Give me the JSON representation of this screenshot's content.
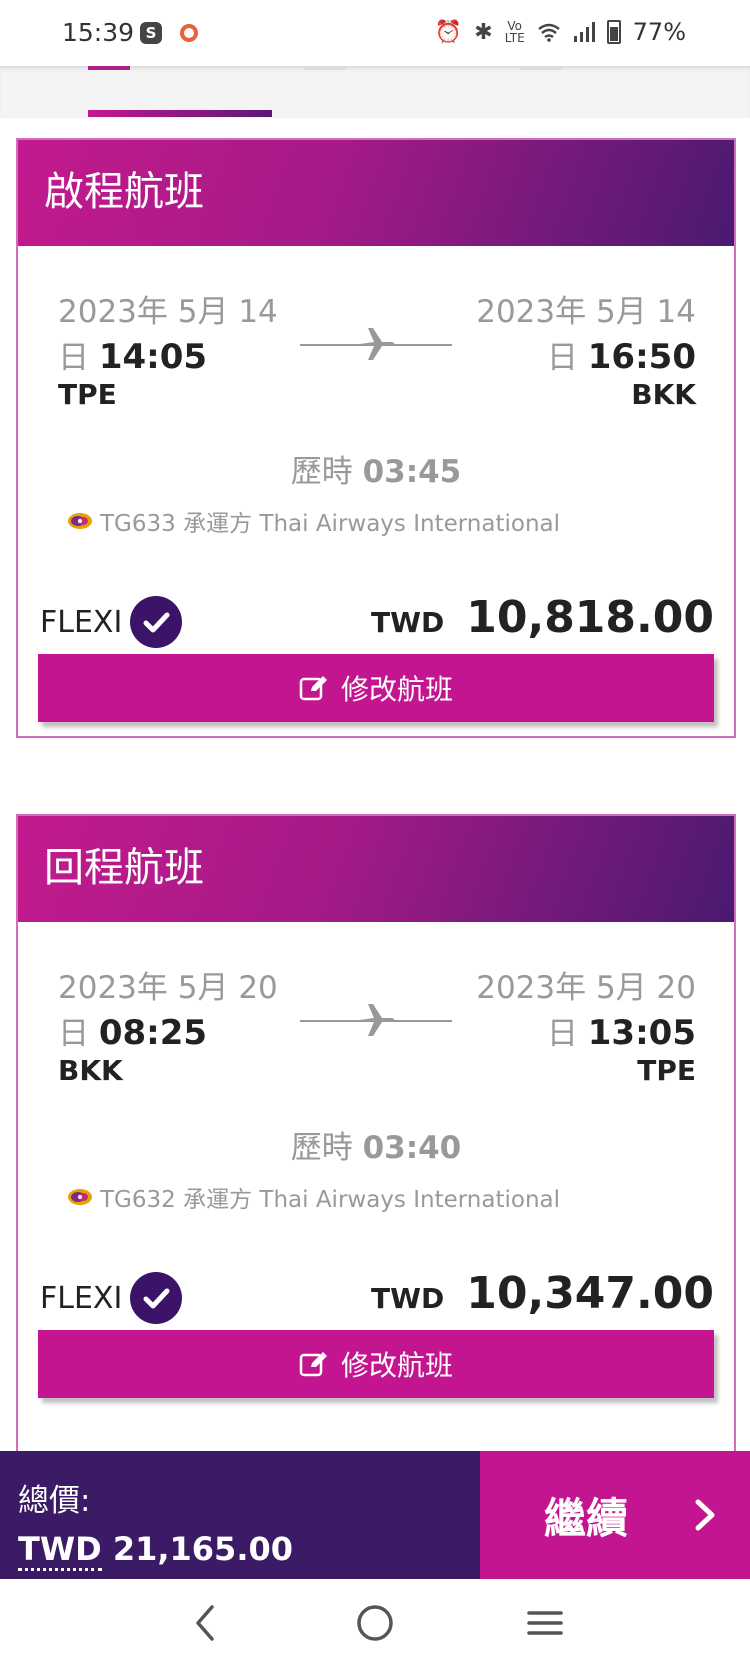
{
  "status_bar": {
    "time": "15:39",
    "app_icon_s": "S",
    "battery": "77%",
    "icons": [
      "alarm-icon",
      "bluetooth-icon",
      "volte-icon",
      "wifi-icon",
      "signal-icon",
      "battery-icon"
    ]
  },
  "outbound": {
    "heading": "啟程航班",
    "depart_date": "2023年 5月 14",
    "depart_day": "日",
    "depart_time": "14:05",
    "depart_airport": "TPE",
    "arrive_date": "2023年 5月 14",
    "arrive_day": "日",
    "arrive_time": "16:50",
    "arrive_airport": "BKK",
    "duration_label": "歷時",
    "duration": "03:45",
    "carrier": "TG633 承運方 Thai Airways International",
    "fare_class": "FLEXI",
    "currency": "TWD",
    "amount": "10,818.00",
    "modify_label": "修改航班"
  },
  "inbound": {
    "heading": "回程航班",
    "depart_date": "2023年 5月 20",
    "depart_day": "日",
    "depart_time": "08:25",
    "depart_airport": "BKK",
    "arrive_date": "2023年 5月 20",
    "arrive_day": "日",
    "arrive_time": "13:05",
    "arrive_airport": "TPE",
    "duration_label": "歷時",
    "duration": "03:40",
    "carrier": "TG632 承運方 Thai Airways International",
    "fare_class": "FLEXI",
    "currency": "TWD",
    "amount": "10,347.00",
    "modify_label": "修改航班"
  },
  "summary": {
    "total_label": "總價:",
    "total_currency": "TWD",
    "total_amount": "21,165.00",
    "continue_label": "繼續"
  },
  "colors": {
    "brand_magenta": "#c41590",
    "brand_purple": "#3b1a66"
  }
}
